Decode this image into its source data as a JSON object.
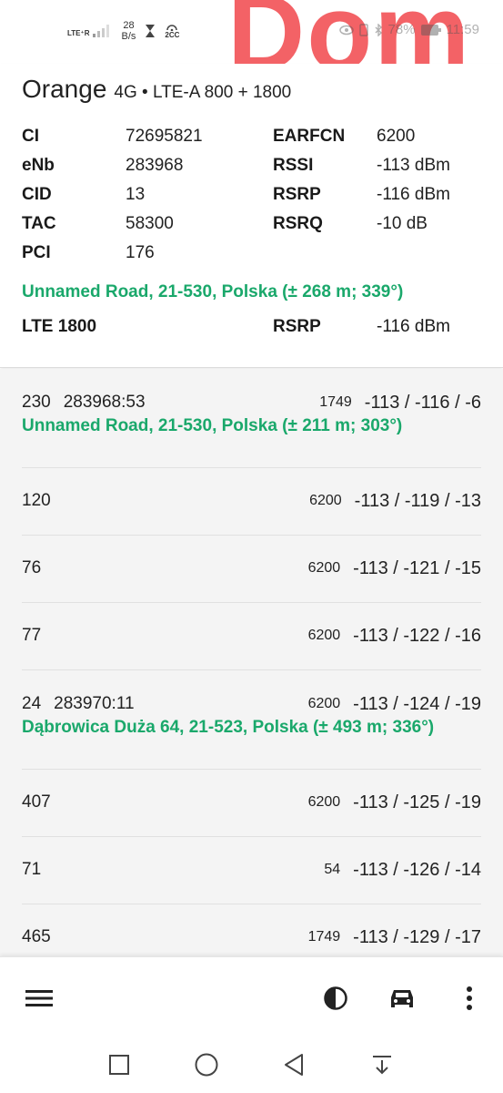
{
  "status_bar": {
    "network": "LTE⁺R",
    "speed_value": "28",
    "speed_unit": "B/s",
    "hotspot": "2CC",
    "battery": "78%",
    "time": "11:59"
  },
  "watermark": "Dom",
  "serving": {
    "operator": "Orange",
    "tech": "4G • LTE-A 800 + 1800",
    "fields": [
      {
        "k1": "CI",
        "v1": "72695821",
        "k2": "EARFCN",
        "v2": "6200"
      },
      {
        "k1": "eNb",
        "v1": "283968",
        "k2": "RSSI",
        "v2": "-113 dBm"
      },
      {
        "k1": "CID",
        "v1": "13",
        "k2": "RSRP",
        "v2": "-116 dBm"
      },
      {
        "k1": "TAC",
        "v1": "58300",
        "k2": "RSRQ",
        "v2": "-10 dB"
      },
      {
        "k1": "PCI",
        "v1": "176",
        "k2": "",
        "v2": ""
      }
    ],
    "address": "Unnamed Road, 21-530, Polska (± 268 m; 339°)",
    "sub_band": "LTE 1800",
    "sub_key": "RSRP",
    "sub_value": "-116 dBm"
  },
  "neighbours": [
    {
      "pci": "230",
      "cell": "283968:53",
      "earfcn": "1749",
      "signal": "-113 / -116 / -6",
      "address": "Unnamed Road, 21-530, Polska (± 211 m; 303°)"
    },
    {
      "pci": "120",
      "cell": "",
      "earfcn": "6200",
      "signal": "-113 / -119 / -13",
      "address": ""
    },
    {
      "pci": "76",
      "cell": "",
      "earfcn": "6200",
      "signal": "-113 / -121 / -15",
      "address": ""
    },
    {
      "pci": "77",
      "cell": "",
      "earfcn": "6200",
      "signal": "-113 / -122 / -16",
      "address": ""
    },
    {
      "pci": "24",
      "cell": "283970:11",
      "earfcn": "6200",
      "signal": "-113 / -124 / -19",
      "address": "Dąbrowica Duża 64, 21-523, Polska (± 493 m; 336°)"
    },
    {
      "pci": "407",
      "cell": "",
      "earfcn": "6200",
      "signal": "-113 / -125 / -19",
      "address": ""
    },
    {
      "pci": "71",
      "cell": "",
      "earfcn": "54",
      "signal": "-113 / -126 / -14",
      "address": ""
    },
    {
      "pci": "465",
      "cell": "",
      "earfcn": "1749",
      "signal": "-113 / -129 / -17",
      "address": ""
    }
  ],
  "app_bar": {
    "icons": [
      "menu-icon",
      "theme-contrast-icon",
      "car-icon",
      "more-vert-icon"
    ]
  },
  "system_nav": {
    "icons": [
      "recents-icon",
      "home-icon",
      "back-icon",
      "notification-pull-icon"
    ]
  },
  "colors": {
    "address_green": "#1aa86b",
    "watermark_red": "#f2555a",
    "list_bg": "#f4f4f4"
  }
}
